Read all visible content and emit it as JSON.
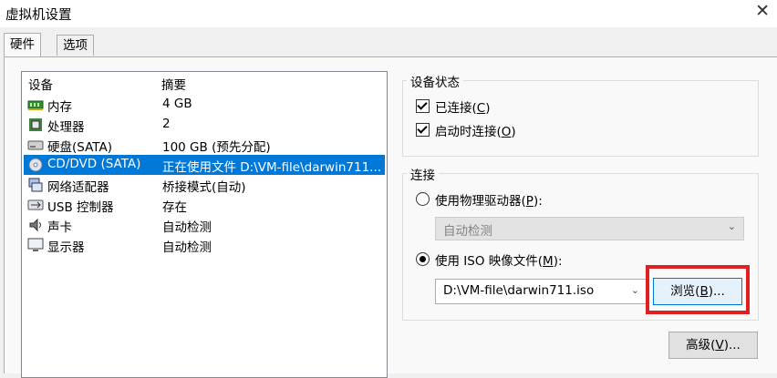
{
  "window": {
    "title": "虚拟机设置",
    "close_glyph": "✕"
  },
  "tabs": [
    {
      "label": "硬件",
      "active": true
    },
    {
      "label": "选项",
      "active": false
    }
  ],
  "device_list": {
    "columns": [
      "设备",
      "摘要"
    ],
    "rows": [
      {
        "device": "内存",
        "summary": "4 GB",
        "icon": "memory-icon",
        "selected": false
      },
      {
        "device": "处理器",
        "summary": "2",
        "icon": "processor-icon",
        "selected": false
      },
      {
        "device": "硬盘(SATA)",
        "summary": "100 GB (预先分配)",
        "icon": "hard-disk-icon",
        "selected": false
      },
      {
        "device": "CD/DVD (SATA)",
        "summary": "正在使用文件 D:\\VM-file\\darwin711...",
        "icon": "cd-dvd-icon",
        "selected": true
      },
      {
        "device": "网络适配器",
        "summary": "桥接模式(自动)",
        "icon": "network-adapter-icon",
        "selected": false
      },
      {
        "device": "USB 控制器",
        "summary": "存在",
        "icon": "usb-icon",
        "selected": false
      },
      {
        "device": "声卡",
        "summary": "自动检测",
        "icon": "sound-card-icon",
        "selected": false
      },
      {
        "device": "显示器",
        "summary": "自动检测",
        "icon": "display-icon",
        "selected": false
      }
    ]
  },
  "device_status": {
    "title": "设备状态",
    "connected": {
      "label": "已连接",
      "key": "C",
      "checked": true
    },
    "connect_at_power_on": {
      "label": "启动时连接",
      "key": "O",
      "checked": true
    }
  },
  "connection": {
    "title": "连接",
    "physical_drive": {
      "label": "使用物理驱动器",
      "key": "P",
      "selected": false,
      "dropdown_value": "自动检测"
    },
    "iso_file": {
      "label": "使用 ISO 映像文件",
      "key": "M",
      "selected": true,
      "path": "D:\\VM-file\\darwin711.iso"
    },
    "browse_button": {
      "label": "浏览",
      "key": "B"
    }
  },
  "advanced_button": {
    "label": "高级",
    "key": "V"
  },
  "colors": {
    "selection": "#0078d7",
    "highlight_box": "#e02020"
  }
}
